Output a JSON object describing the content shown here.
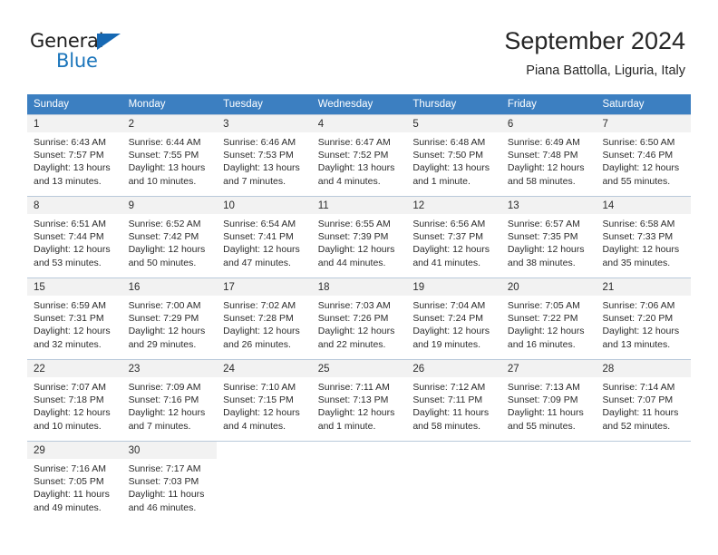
{
  "brand": {
    "name_top": "General",
    "name_bottom": "Blue",
    "accent_color": "#1b75bb",
    "flag_color": "#1668b3"
  },
  "header": {
    "title": "September 2024",
    "subtitle": "Piana Battolla, Liguria, Italy"
  },
  "calendar": {
    "header_bg": "#3c7fc1",
    "day_band_bg": "#f2f2f2",
    "weekdays": [
      "Sunday",
      "Monday",
      "Tuesday",
      "Wednesday",
      "Thursday",
      "Friday",
      "Saturday"
    ],
    "weeks": [
      [
        {
          "day": "1",
          "sunrise": "Sunrise: 6:43 AM",
          "sunset": "Sunset: 7:57 PM",
          "daylight_1": "Daylight: 13 hours",
          "daylight_2": "and 13 minutes."
        },
        {
          "day": "2",
          "sunrise": "Sunrise: 6:44 AM",
          "sunset": "Sunset: 7:55 PM",
          "daylight_1": "Daylight: 13 hours",
          "daylight_2": "and 10 minutes."
        },
        {
          "day": "3",
          "sunrise": "Sunrise: 6:46 AM",
          "sunset": "Sunset: 7:53 PM",
          "daylight_1": "Daylight: 13 hours",
          "daylight_2": "and 7 minutes."
        },
        {
          "day": "4",
          "sunrise": "Sunrise: 6:47 AM",
          "sunset": "Sunset: 7:52 PM",
          "daylight_1": "Daylight: 13 hours",
          "daylight_2": "and 4 minutes."
        },
        {
          "day": "5",
          "sunrise": "Sunrise: 6:48 AM",
          "sunset": "Sunset: 7:50 PM",
          "daylight_1": "Daylight: 13 hours",
          "daylight_2": "and 1 minute."
        },
        {
          "day": "6",
          "sunrise": "Sunrise: 6:49 AM",
          "sunset": "Sunset: 7:48 PM",
          "daylight_1": "Daylight: 12 hours",
          "daylight_2": "and 58 minutes."
        },
        {
          "day": "7",
          "sunrise": "Sunrise: 6:50 AM",
          "sunset": "Sunset: 7:46 PM",
          "daylight_1": "Daylight: 12 hours",
          "daylight_2": "and 55 minutes."
        }
      ],
      [
        {
          "day": "8",
          "sunrise": "Sunrise: 6:51 AM",
          "sunset": "Sunset: 7:44 PM",
          "daylight_1": "Daylight: 12 hours",
          "daylight_2": "and 53 minutes."
        },
        {
          "day": "9",
          "sunrise": "Sunrise: 6:52 AM",
          "sunset": "Sunset: 7:42 PM",
          "daylight_1": "Daylight: 12 hours",
          "daylight_2": "and 50 minutes."
        },
        {
          "day": "10",
          "sunrise": "Sunrise: 6:54 AM",
          "sunset": "Sunset: 7:41 PM",
          "daylight_1": "Daylight: 12 hours",
          "daylight_2": "and 47 minutes."
        },
        {
          "day": "11",
          "sunrise": "Sunrise: 6:55 AM",
          "sunset": "Sunset: 7:39 PM",
          "daylight_1": "Daylight: 12 hours",
          "daylight_2": "and 44 minutes."
        },
        {
          "day": "12",
          "sunrise": "Sunrise: 6:56 AM",
          "sunset": "Sunset: 7:37 PM",
          "daylight_1": "Daylight: 12 hours",
          "daylight_2": "and 41 minutes."
        },
        {
          "day": "13",
          "sunrise": "Sunrise: 6:57 AM",
          "sunset": "Sunset: 7:35 PM",
          "daylight_1": "Daylight: 12 hours",
          "daylight_2": "and 38 minutes."
        },
        {
          "day": "14",
          "sunrise": "Sunrise: 6:58 AM",
          "sunset": "Sunset: 7:33 PM",
          "daylight_1": "Daylight: 12 hours",
          "daylight_2": "and 35 minutes."
        }
      ],
      [
        {
          "day": "15",
          "sunrise": "Sunrise: 6:59 AM",
          "sunset": "Sunset: 7:31 PM",
          "daylight_1": "Daylight: 12 hours",
          "daylight_2": "and 32 minutes."
        },
        {
          "day": "16",
          "sunrise": "Sunrise: 7:00 AM",
          "sunset": "Sunset: 7:29 PM",
          "daylight_1": "Daylight: 12 hours",
          "daylight_2": "and 29 minutes."
        },
        {
          "day": "17",
          "sunrise": "Sunrise: 7:02 AM",
          "sunset": "Sunset: 7:28 PM",
          "daylight_1": "Daylight: 12 hours",
          "daylight_2": "and 26 minutes."
        },
        {
          "day": "18",
          "sunrise": "Sunrise: 7:03 AM",
          "sunset": "Sunset: 7:26 PM",
          "daylight_1": "Daylight: 12 hours",
          "daylight_2": "and 22 minutes."
        },
        {
          "day": "19",
          "sunrise": "Sunrise: 7:04 AM",
          "sunset": "Sunset: 7:24 PM",
          "daylight_1": "Daylight: 12 hours",
          "daylight_2": "and 19 minutes."
        },
        {
          "day": "20",
          "sunrise": "Sunrise: 7:05 AM",
          "sunset": "Sunset: 7:22 PM",
          "daylight_1": "Daylight: 12 hours",
          "daylight_2": "and 16 minutes."
        },
        {
          "day": "21",
          "sunrise": "Sunrise: 7:06 AM",
          "sunset": "Sunset: 7:20 PM",
          "daylight_1": "Daylight: 12 hours",
          "daylight_2": "and 13 minutes."
        }
      ],
      [
        {
          "day": "22",
          "sunrise": "Sunrise: 7:07 AM",
          "sunset": "Sunset: 7:18 PM",
          "daylight_1": "Daylight: 12 hours",
          "daylight_2": "and 10 minutes."
        },
        {
          "day": "23",
          "sunrise": "Sunrise: 7:09 AM",
          "sunset": "Sunset: 7:16 PM",
          "daylight_1": "Daylight: 12 hours",
          "daylight_2": "and 7 minutes."
        },
        {
          "day": "24",
          "sunrise": "Sunrise: 7:10 AM",
          "sunset": "Sunset: 7:15 PM",
          "daylight_1": "Daylight: 12 hours",
          "daylight_2": "and 4 minutes."
        },
        {
          "day": "25",
          "sunrise": "Sunrise: 7:11 AM",
          "sunset": "Sunset: 7:13 PM",
          "daylight_1": "Daylight: 12 hours",
          "daylight_2": "and 1 minute."
        },
        {
          "day": "26",
          "sunrise": "Sunrise: 7:12 AM",
          "sunset": "Sunset: 7:11 PM",
          "daylight_1": "Daylight: 11 hours",
          "daylight_2": "and 58 minutes."
        },
        {
          "day": "27",
          "sunrise": "Sunrise: 7:13 AM",
          "sunset": "Sunset: 7:09 PM",
          "daylight_1": "Daylight: 11 hours",
          "daylight_2": "and 55 minutes."
        },
        {
          "day": "28",
          "sunrise": "Sunrise: 7:14 AM",
          "sunset": "Sunset: 7:07 PM",
          "daylight_1": "Daylight: 11 hours",
          "daylight_2": "and 52 minutes."
        }
      ],
      [
        {
          "day": "29",
          "sunrise": "Sunrise: 7:16 AM",
          "sunset": "Sunset: 7:05 PM",
          "daylight_1": "Daylight: 11 hours",
          "daylight_2": "and 49 minutes."
        },
        {
          "day": "30",
          "sunrise": "Sunrise: 7:17 AM",
          "sunset": "Sunset: 7:03 PM",
          "daylight_1": "Daylight: 11 hours",
          "daylight_2": "and 46 minutes."
        },
        {
          "day": "",
          "sunrise": "",
          "sunset": "",
          "daylight_1": "",
          "daylight_2": ""
        },
        {
          "day": "",
          "sunrise": "",
          "sunset": "",
          "daylight_1": "",
          "daylight_2": ""
        },
        {
          "day": "",
          "sunrise": "",
          "sunset": "",
          "daylight_1": "",
          "daylight_2": ""
        },
        {
          "day": "",
          "sunrise": "",
          "sunset": "",
          "daylight_1": "",
          "daylight_2": ""
        },
        {
          "day": "",
          "sunrise": "",
          "sunset": "",
          "daylight_1": "",
          "daylight_2": ""
        }
      ]
    ]
  }
}
